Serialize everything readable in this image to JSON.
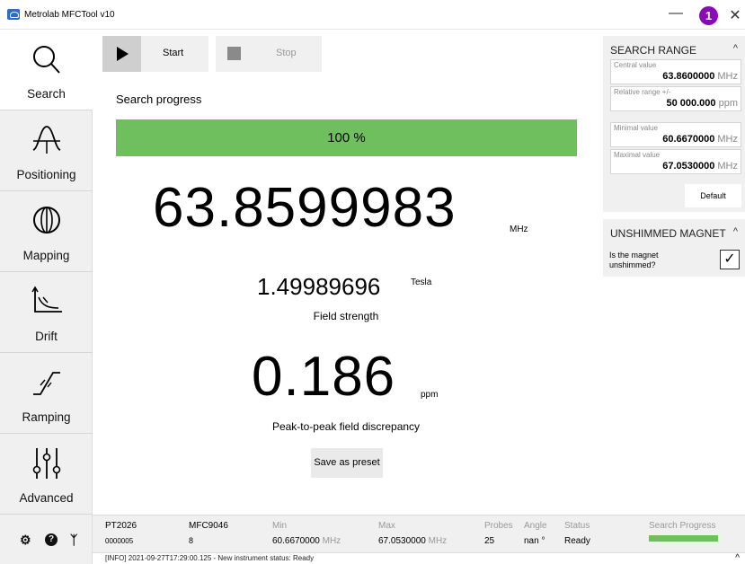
{
  "window": {
    "title": "Metrolab MFCTool v10",
    "minimize": "—",
    "close": "✕",
    "badge": "1"
  },
  "sidebar": {
    "items": [
      {
        "label": "Search",
        "icon": "search-icon",
        "active": true
      },
      {
        "label": "Positioning",
        "icon": "positioning-icon"
      },
      {
        "label": "Mapping",
        "icon": "mapping-icon"
      },
      {
        "label": "Drift",
        "icon": "drift-icon"
      },
      {
        "label": "Ramping",
        "icon": "ramping-icon"
      },
      {
        "label": "Advanced",
        "icon": "advanced-icon"
      }
    ],
    "bottom_icons": [
      "gear-icon",
      "help-icon",
      "network-icon"
    ]
  },
  "toolbar": {
    "start_label": "Start",
    "stop_label": "Stop"
  },
  "main": {
    "search_progress_label": "Search progress",
    "progress_percent": 100,
    "progress_text": "100 %",
    "frequency": "63.8599983",
    "frequency_unit": "MHz",
    "field": "1.49989696",
    "field_unit": "Tesla",
    "field_label": "Field strength",
    "discrepancy": "0.186",
    "discrepancy_unit": "ppm",
    "discrepancy_label": "Peak-to-peak field discrepancy",
    "save_preset_label": "Save as preset"
  },
  "search_range": {
    "title": "SEARCH RANGE",
    "caret": "^",
    "central_label": "Central value",
    "central_value": "63.8600000",
    "central_unit": "MHz",
    "relative_label": "Relative range +/-",
    "relative_value": "50 000.000",
    "relative_unit": "ppm",
    "min_label": "Minimal value",
    "min_value": "60.6670000",
    "min_unit": "MHz",
    "max_label": "Maximal value",
    "max_value": "67.0530000",
    "max_unit": "MHz",
    "default_label": "Default"
  },
  "unshimmed": {
    "title": "UNSHIMMED MAGNET",
    "caret": "^",
    "question": "Is the magnet unshimmed?",
    "checked": true,
    "check_glyph": "✓"
  },
  "status": {
    "probe_model": "PT2026",
    "probe_serial": "0000005",
    "mfc_model": "MFC9046",
    "mfc_value": "8",
    "min_header": "Min",
    "min_value": "60.6670000",
    "min_unit": "MHz",
    "max_header": "Max",
    "max_value": "67.0530000",
    "max_unit": "MHz",
    "probes_header": "Probes",
    "probes_value": "25",
    "angle_header": "Angle",
    "angle_value": "nan °",
    "status_header": "Status",
    "status_value": "Ready",
    "search_progress_header": "Search Progress",
    "search_progress_percent": 100
  },
  "log": {
    "text": "[INFO] 2021-09-27T17:29:00.125 - New instrument status: Ready",
    "caret": "^"
  },
  "colors": {
    "progress": "#6fbf5f",
    "badge": "#8a0bb5",
    "sidebar_bg": "#f0f0f0"
  }
}
